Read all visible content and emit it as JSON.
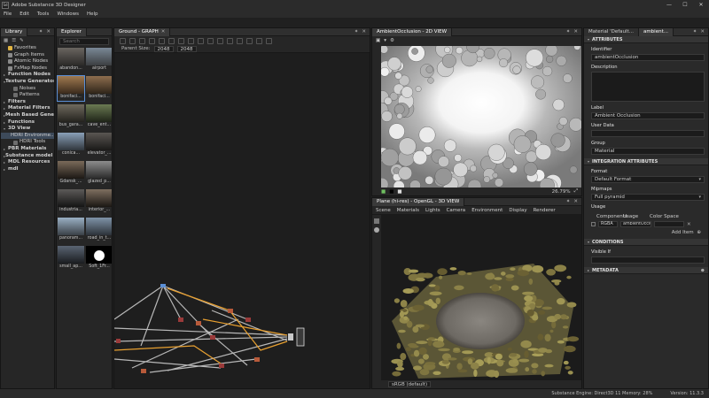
{
  "app": {
    "title": "Adobe Substance 3D Designer",
    "logo": "Sd"
  },
  "window_buttons": {
    "minimize": "—",
    "maximize": "☐",
    "close": "✕"
  },
  "menu": [
    "File",
    "Edit",
    "Tools",
    "Windows",
    "Help"
  ],
  "library": {
    "tab": "Library",
    "items": [
      {
        "label": "Favorites",
        "arrow": "",
        "icon_color": "#e0b341"
      },
      {
        "label": "Graph Items",
        "arrow": "",
        "icon_color": "#8a8a8a"
      },
      {
        "label": "Atomic Nodes",
        "arrow": "",
        "icon_color": "#8a8a8a"
      },
      {
        "label": "FxMap Nodes",
        "arrow": "",
        "icon_color": "#8a8a8a"
      },
      {
        "label": "Function Nodes",
        "arrow": "▸",
        "icon_color": ""
      },
      {
        "label": "Texture Generators",
        "arrow": "▾",
        "icon_color": ""
      },
      {
        "label": "Noises",
        "arrow": "",
        "icon_color": "#6d6d6d",
        "indent": true
      },
      {
        "label": "Patterns",
        "arrow": "",
        "icon_color": "#6d6d6d",
        "indent": true
      },
      {
        "label": "Filters",
        "arrow": "▸",
        "icon_color": ""
      },
      {
        "label": "Material Filters",
        "arrow": "▸",
        "icon_color": ""
      },
      {
        "label": "Mesh Based Gener...",
        "arrow": "▸",
        "icon_color": ""
      },
      {
        "label": "Functions",
        "arrow": "▸",
        "icon_color": ""
      },
      {
        "label": "3D View",
        "arrow": "▾",
        "icon_color": ""
      },
      {
        "label": "HDRI Environme...",
        "arrow": "",
        "icon_color": "#6d6d6d",
        "indent": true,
        "selected": true
      },
      {
        "label": "HDRI Tools",
        "arrow": "",
        "icon_color": "#6d6d6d",
        "indent": true
      },
      {
        "label": "PBR Materials",
        "arrow": "▸",
        "icon_color": ""
      },
      {
        "label": "Substance model g...",
        "arrow": "▸",
        "icon_color": ""
      },
      {
        "label": "MDL Resources",
        "arrow": "▸",
        "icon_color": ""
      },
      {
        "label": "mdl",
        "arrow": "▸",
        "icon_color": ""
      }
    ]
  },
  "explorer": {
    "tab": "Explorer",
    "search_placeholder": "Search",
    "thumbs": [
      {
        "label": "abandon...",
        "c1": "#6a6560",
        "c2": "#2b2a28"
      },
      {
        "label": "airport",
        "c1": "#7a8896",
        "c2": "#3c3f42"
      },
      {
        "label": "bonifaci...",
        "c1": "#a07a50",
        "c2": "#3a2a1c",
        "selected": true
      },
      {
        "label": "bonifaci...",
        "c1": "#8e6e4e",
        "c2": "#2e2419"
      },
      {
        "label": "bus_gara...",
        "c1": "#6f6a5e",
        "c2": "#24221e"
      },
      {
        "label": "cave_ent...",
        "c1": "#6b7a52",
        "c2": "#1e2418"
      },
      {
        "label": "conica...",
        "c1": "#8aa0b8",
        "c2": "#30363c"
      },
      {
        "label": "elevator_...",
        "c1": "#5a5652",
        "c2": "#1a1918"
      },
      {
        "label": "Gdansk_...",
        "c1": "#7a6a5a",
        "c2": "#1c1814"
      },
      {
        "label": "glazed_p...",
        "c1": "#8d8d8d",
        "c2": "#2a2a2a"
      },
      {
        "label": "industria...",
        "c1": "#5c5a58",
        "c2": "#141414"
      },
      {
        "label": "interior_...",
        "c1": "#7f6f60",
        "c2": "#1b1713"
      },
      {
        "label": "panoram...",
        "c1": "#9ab0c4",
        "c2": "#3a4046"
      },
      {
        "label": "road_in_t...",
        "c1": "#7f93a8",
        "c2": "#2c3238"
      },
      {
        "label": "small_ap...",
        "c1": "#5a6472",
        "c2": "#1a1c20"
      },
      {
        "label": "Soft_1Fr...",
        "c1": "#000000",
        "c2": "#000000",
        "softbox": true
      }
    ]
  },
  "graph": {
    "tab": "Ground - GRAPH",
    "parent_size_label": "Parent Size:",
    "size_x": "2048",
    "size_y": "2048",
    "node_label": "154"
  },
  "view2d": {
    "tab": "AmbientOcclusion - 2D VIEW",
    "zoom": "26.79%"
  },
  "view3d": {
    "tab": "Plane (hi-res) - OpenGL - 3D VIEW",
    "menu": [
      "Scene",
      "Materials",
      "Lights",
      "Camera",
      "Environment",
      "Display",
      "Renderer"
    ],
    "colorspace": "sRGB (default)"
  },
  "attributes_panel": {
    "tabs": [
      {
        "label": "Material 'Default..."
      },
      {
        "label": "ambient..."
      }
    ],
    "attributes_head": "ATTRIBUTES",
    "identifier_label": "Identifier",
    "identifier": "ambientOcclusion",
    "description_label": "Description",
    "label_label": "Label",
    "label": "Ambient Occlusion",
    "userdata_label": "User Data",
    "group_label": "Group",
    "group": "Material",
    "integration_head": "INTEGRATION ATTRIBUTES",
    "format_label": "Format",
    "format": "Default Format",
    "mipmaps_label": "Mipmaps",
    "mipmaps": "Full pyramid",
    "usage_label": "Usage",
    "usage_cols": [
      "Components",
      "Usage",
      "Color Space"
    ],
    "usage_components": "RGBA",
    "usage_usage": "ambientOcclusion",
    "add_item": "Add Item",
    "conditions_head": "CONDITIONS",
    "visible_if_label": "Visible If",
    "metadata_head": "METADATA"
  },
  "status": {
    "engine": "Substance Engine: Direct3D 11  Memory: 28%",
    "version": "Version: 11.3.3"
  },
  "colors": {
    "accent": "#5b8fd6",
    "wire_orange": "#e8a030",
    "wire_gray": "#b8b8b8",
    "panel": "#262626"
  }
}
